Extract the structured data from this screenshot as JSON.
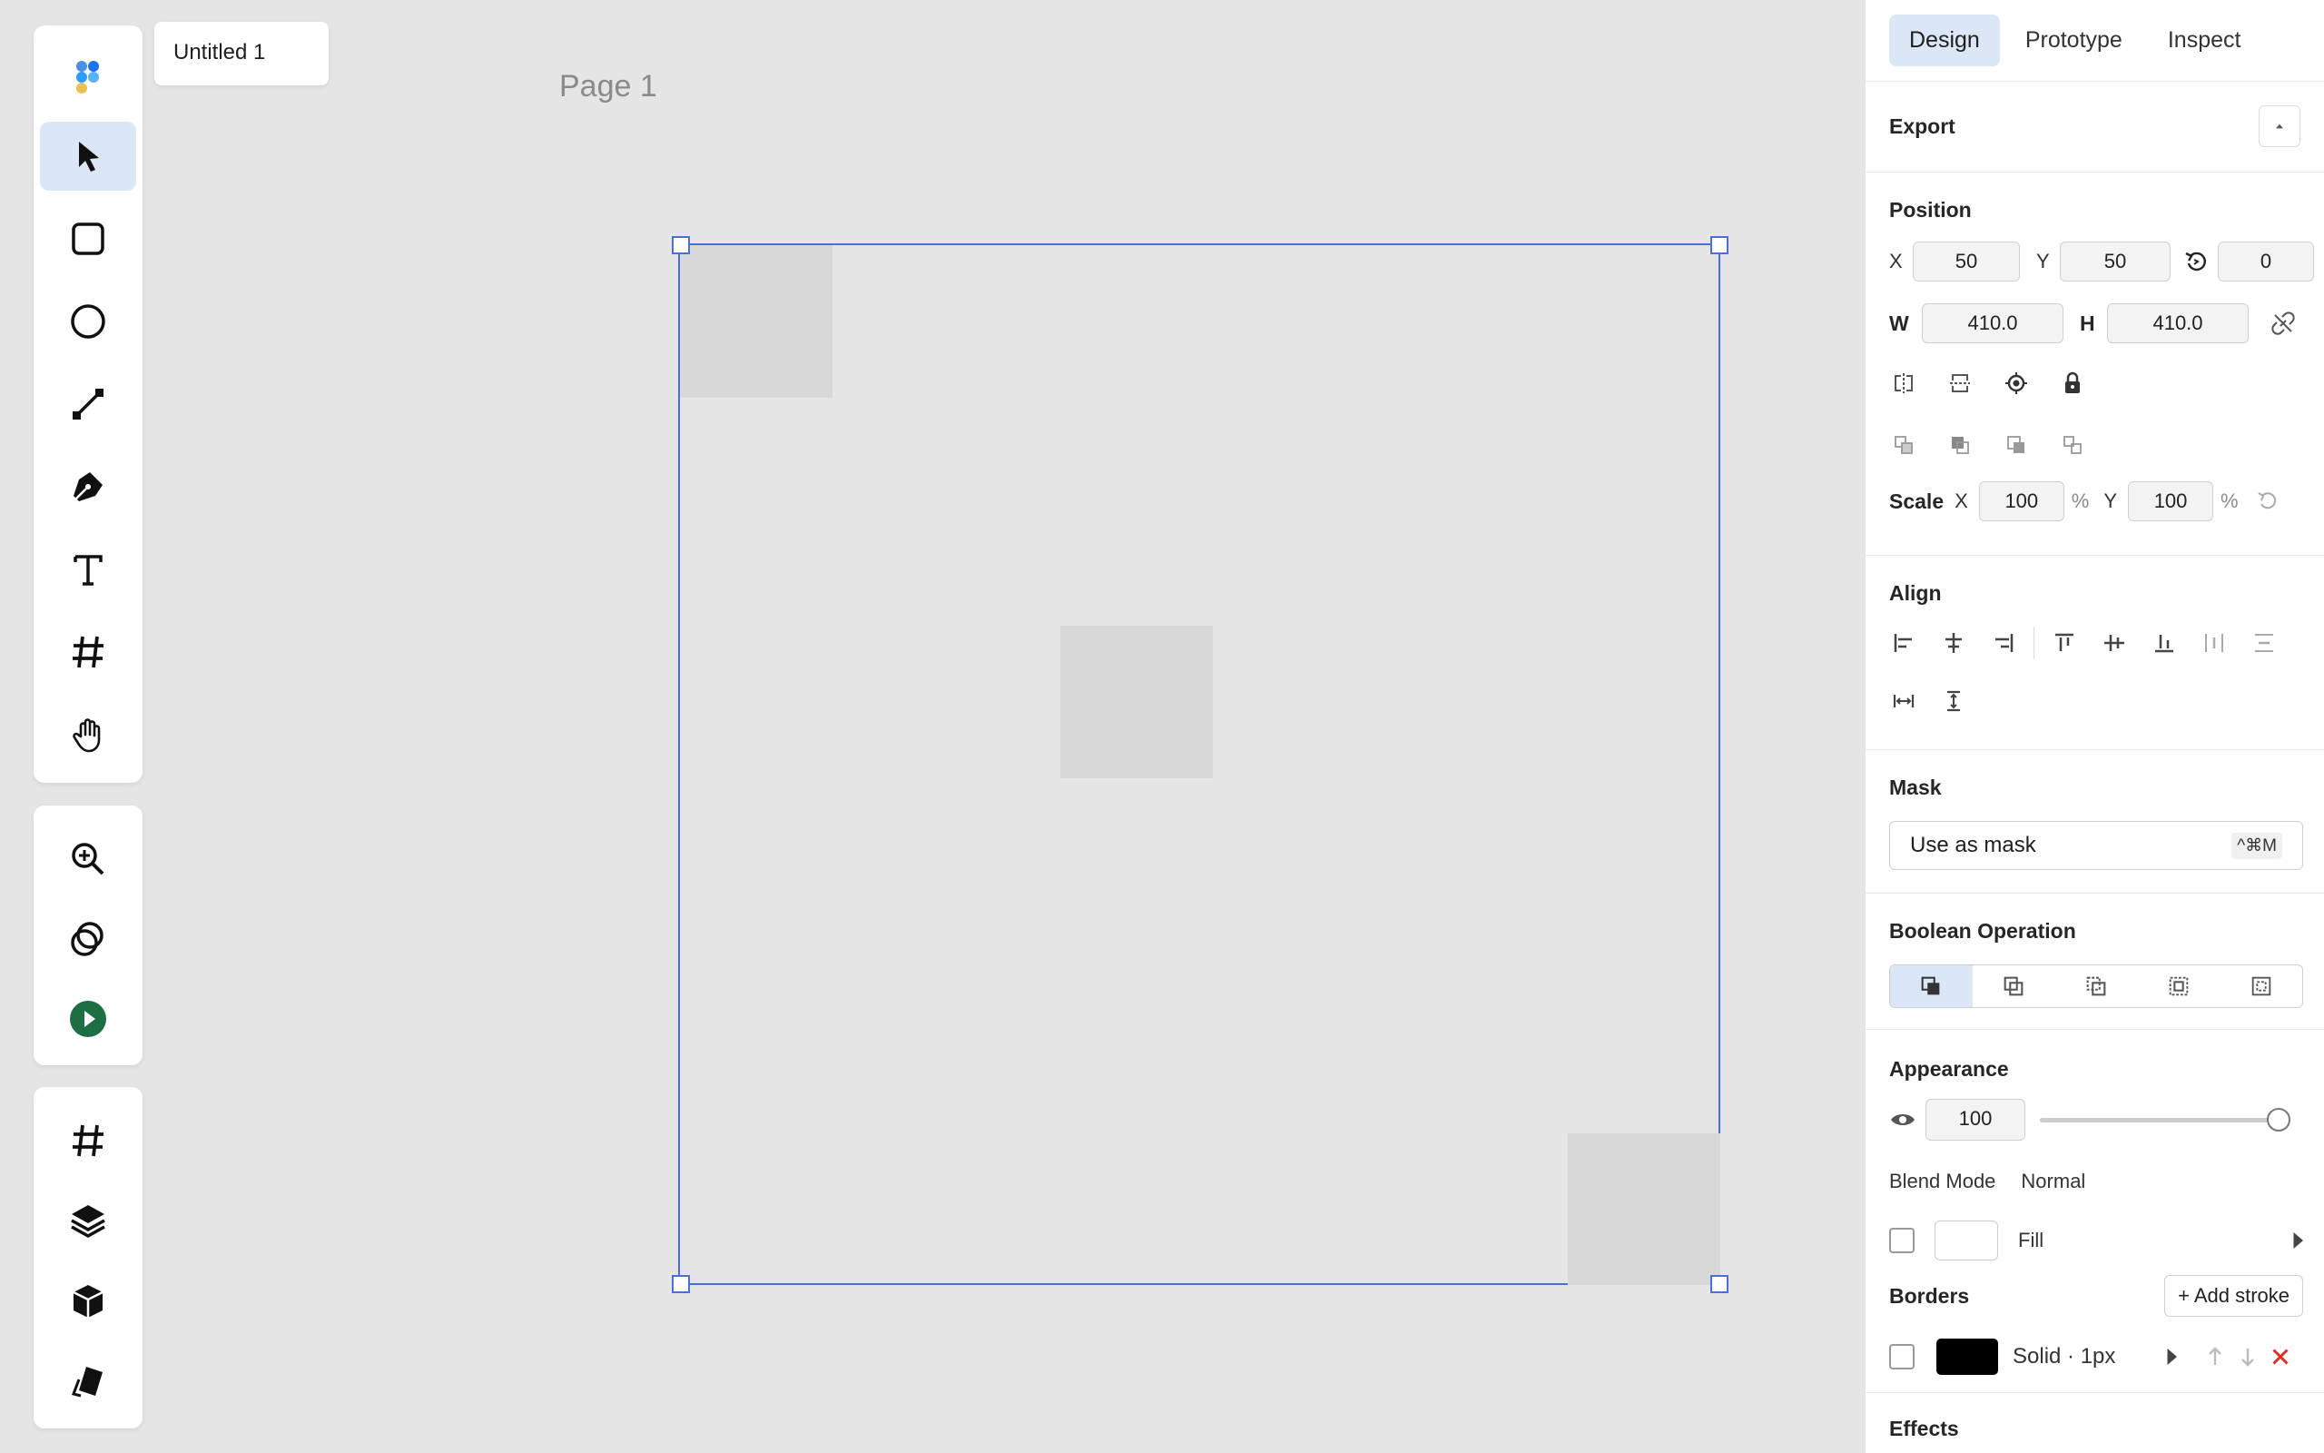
{
  "app": {
    "doc_tab": "Untitled 1",
    "page_label": "Page 1"
  },
  "tools": {
    "main": [
      "logo-icon",
      "select-icon",
      "rectangle-icon",
      "ellipse-icon",
      "line-icon",
      "pen-icon",
      "text-icon",
      "frame-icon",
      "hand-icon"
    ],
    "view": [
      "zoom-icon",
      "boolean-icon",
      "play-icon"
    ],
    "panels": [
      "frames-icon",
      "layers-icon",
      "assets-icon",
      "components-icon"
    ]
  },
  "panel": {
    "tabs": [
      {
        "label": "Design",
        "active": true
      },
      {
        "label": "Prototype",
        "active": false
      },
      {
        "label": "Inspect",
        "active": false
      }
    ],
    "export": {
      "title": "Export"
    },
    "position": {
      "title": "Position",
      "x_label": "X",
      "x": "50",
      "y_label": "Y",
      "y": "50",
      "rotation": "0",
      "w_label": "W",
      "w": "410.0",
      "h_label": "H",
      "h": "410.0",
      "scale_label": "Scale",
      "scale_x_label": "X",
      "scale_x": "100",
      "scale_x_unit": "%",
      "scale_y_label": "Y",
      "scale_y": "100",
      "scale_y_unit": "%"
    },
    "align": {
      "title": "Align"
    },
    "mask": {
      "title": "Mask",
      "button": "Use as mask",
      "shortcut": "^⌘M"
    },
    "boolean": {
      "title": "Boolean Operation"
    },
    "appearance": {
      "title": "Appearance",
      "opacity": "100",
      "opacity_level": 1.0,
      "blend_label": "Blend Mode",
      "blend_value": "Normal",
      "fill_label": "Fill",
      "fill_color": "#ffffff"
    },
    "borders": {
      "title": "Borders",
      "add_stroke": "+ Add stroke",
      "stroke_label": "Solid · 1px",
      "stroke_color": "#000000"
    },
    "effects": {
      "title": "Effects"
    }
  },
  "colors": {
    "accent": "#4a6fd8",
    "active_bg": "#dbe6f7",
    "play_green": "#1e6e44",
    "delete_red": "#d93025"
  }
}
